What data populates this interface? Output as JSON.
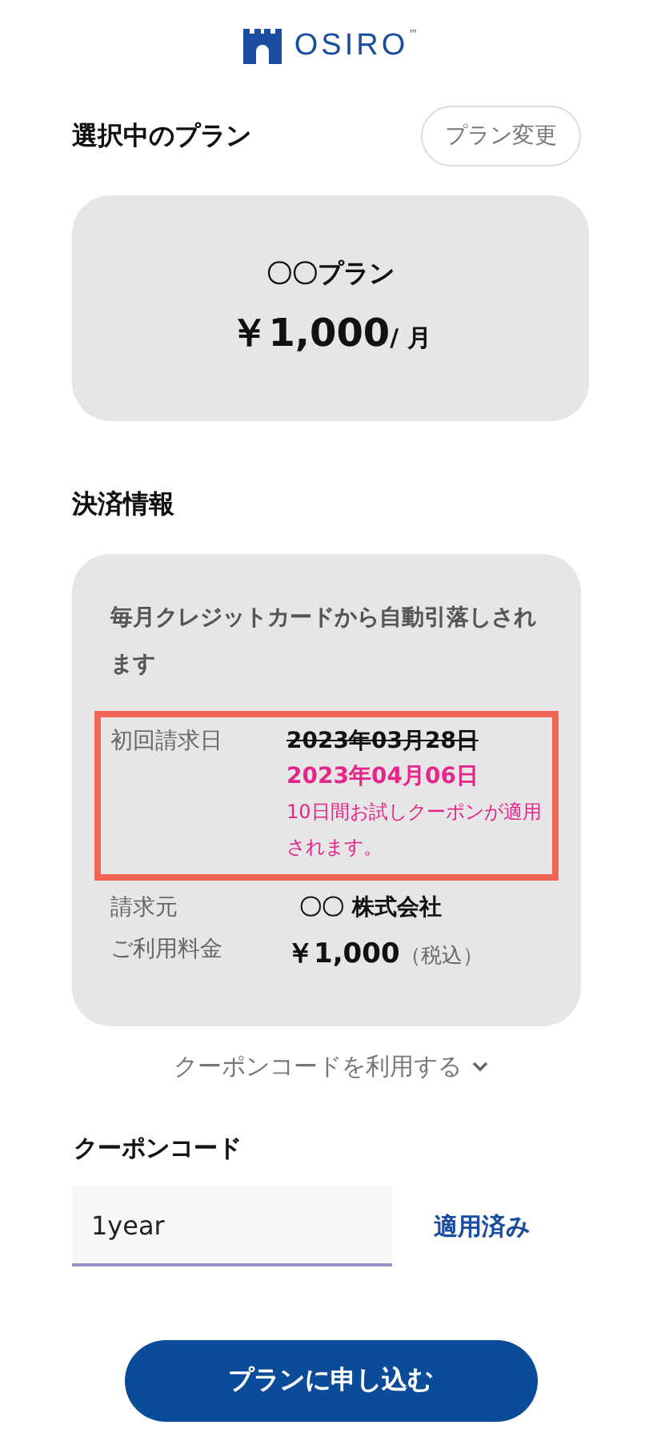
{
  "logo": {
    "name": "OSIRO",
    "mark": "™"
  },
  "plan_section": {
    "title": "選択中のプラン",
    "change_button": "プラン変更"
  },
  "plan_card": {
    "name": "〇〇プラン",
    "price": "￥1,000",
    "unit": "/ 月"
  },
  "payment_section": {
    "title": "決済情報"
  },
  "payment_card": {
    "description": "毎月クレジットカードから自動引落しされます",
    "rows": [
      {
        "kind": "first_billing",
        "label": "初回請求日",
        "old_date": "2023年03月28日",
        "new_date": "2023年04月06日",
        "note": "10日間お試しクーポンが適用されます。",
        "highlighted": true
      },
      {
        "kind": "issuer",
        "label": "請求元",
        "value": "〇〇 株式会社"
      },
      {
        "kind": "fee",
        "label": "ご利用料金",
        "value": "￥1,000",
        "suffix": "（税込）"
      }
    ]
  },
  "coupon_toggle": {
    "label": "クーポンコードを利用する",
    "expanded": true
  },
  "coupon": {
    "label": "クーポンコード",
    "value": "1year",
    "status": "適用済み"
  },
  "submit_button": "プランに申し込む"
}
